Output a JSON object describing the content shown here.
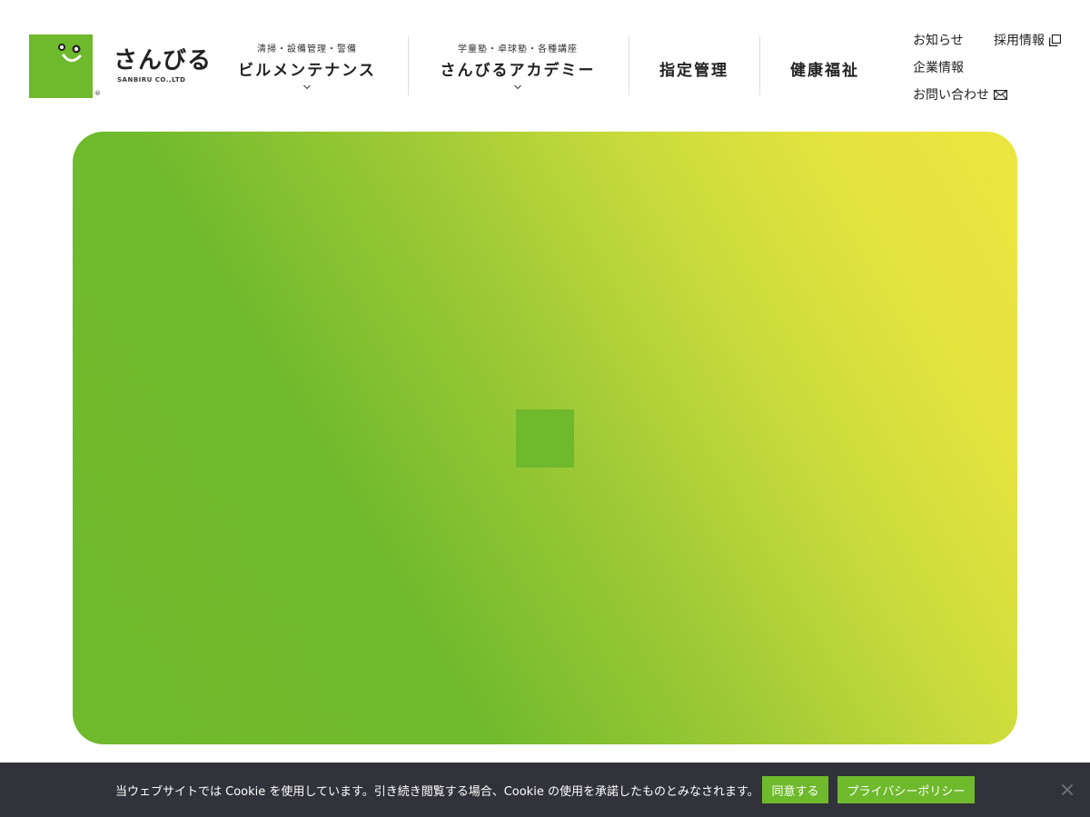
{
  "brand": {
    "name": "さんびる",
    "sub": "SANBIRU CO.,LTD",
    "reg": "®",
    "colors": {
      "green": "#6fb92c",
      "yellow": "#ece53f",
      "dark": "#32323a"
    }
  },
  "nav": [
    {
      "sub": "清掃・設備管理・警備",
      "label": "ビルメンテナンス",
      "has_dropdown": true
    },
    {
      "sub": "学童塾・卓球塾・各種講座",
      "label": "さんびるアカデミー",
      "has_dropdown": true
    },
    {
      "label": "指定管理"
    },
    {
      "label": "健康福祉"
    }
  ],
  "utility": {
    "news": "お知らせ",
    "recruit": "採用情報",
    "company": "企業情報",
    "contact": "お問い合わせ",
    "icons": {
      "recruit": "external-window-icon",
      "contact": "mail-icon"
    }
  },
  "cookie": {
    "message": "当ウェブサイトでは Cookie を使用しています。引き続き閲覧する場合、Cookie の使用を承諾したものとみなされます。",
    "accept": "同意する",
    "policy": "プライバシーポリシー"
  }
}
